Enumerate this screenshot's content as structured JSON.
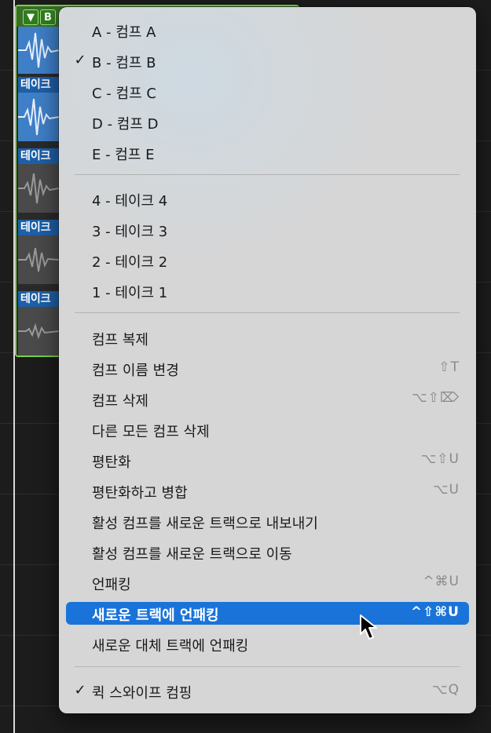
{
  "background": {
    "group_button_label": "▼",
    "group_comp_letter": "B",
    "take_label": "테이크"
  },
  "menu": {
    "comps": [
      {
        "label": "A - 컴프 A",
        "checked": false
      },
      {
        "label": "B - 컴프 B",
        "checked": true
      },
      {
        "label": "C - 컴프 C",
        "checked": false
      },
      {
        "label": "D - 컴프 D",
        "checked": false
      },
      {
        "label": "E - 컴프 E",
        "checked": false
      }
    ],
    "takes": [
      {
        "label": "4 - 테이크 4"
      },
      {
        "label": "3 - 테이크 3"
      },
      {
        "label": "2 - 테이크 2"
      },
      {
        "label": "1 - 테이크 1"
      }
    ],
    "actions": [
      {
        "label": "컴프 복제",
        "shortcut": ""
      },
      {
        "label": "컴프 이름 변경",
        "shortcut": "⇧T"
      },
      {
        "label": "컴프 삭제",
        "shortcut": "⌥⇧⌦"
      },
      {
        "label": "다른 모든 컴프 삭제",
        "shortcut": ""
      },
      {
        "label": "평탄화",
        "shortcut": "⌥⇧U"
      },
      {
        "label": "평탄화하고 병합",
        "shortcut": "⌥U"
      },
      {
        "label": "활성 컴프를 새로운 트랙으로 내보내기",
        "shortcut": ""
      },
      {
        "label": "활성 컴프를 새로운 트랙으로 이동",
        "shortcut": ""
      },
      {
        "label": "언패킹",
        "shortcut": "^⌘U"
      },
      {
        "label": "새로운 트랙에 언패킹",
        "shortcut": "^⇧⌘U",
        "highlighted": true
      },
      {
        "label": "새로운 대체 트랙에 언패킹",
        "shortcut": ""
      }
    ],
    "quick_swipe": {
      "label": "퀵 스와이프 컴핑",
      "shortcut": "⌥Q",
      "checked": true
    },
    "check_mark": "✓"
  },
  "colors": {
    "highlight": "#1a73d9",
    "group_border": "#7bcf4a",
    "take_active": "#3f7fc7"
  }
}
